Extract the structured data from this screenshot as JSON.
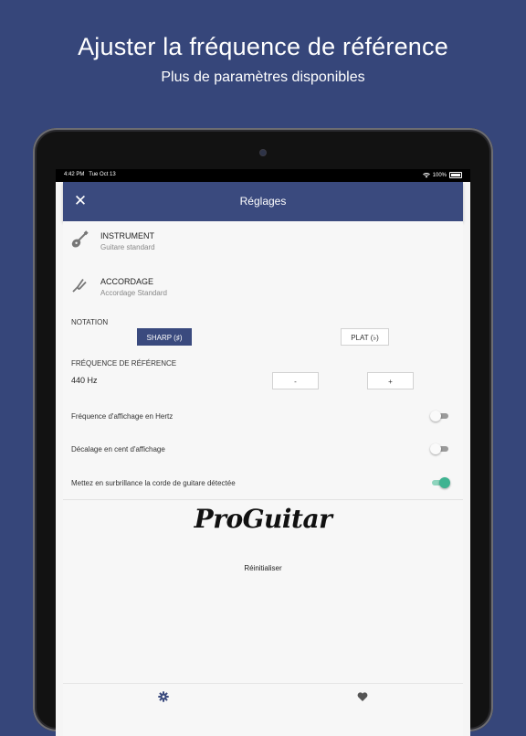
{
  "promo": {
    "title": "Ajuster la fréquence de référence",
    "subtitle": "Plus de paramètres disponibles"
  },
  "status_bar": {
    "time": "4:42 PM",
    "date": "Tue Oct 13",
    "battery": "100%"
  },
  "modal": {
    "title": "Réglages",
    "close_icon": "close-icon"
  },
  "settings": {
    "instrument": {
      "title": "INSTRUMENT",
      "value": "Guitare standard",
      "icon": "guitar-icon"
    },
    "tuning": {
      "title": "ACCORDAGE",
      "value": "Accordage Standard",
      "icon": "tuning-fork-icon"
    },
    "notation": {
      "label": "NOTATION",
      "options": [
        "SHARP (♯)",
        "PLAT (♭)"
      ],
      "selected": "SHARP (♯)"
    },
    "reference_frequency": {
      "label": "FRÉQUENCE DE RÉFÉRENCE",
      "value": "440 Hz",
      "decrement_label": "-",
      "increment_label": "+"
    },
    "toggles": [
      {
        "label": "Fréquence d'affichage en Hertz",
        "on": false
      },
      {
        "label": "Décalage en cent d'affichage",
        "on": false
      },
      {
        "label": "Mettez en surbrillance la corde de guitare détectée",
        "on": true
      }
    ]
  },
  "logo_text": "ProGuitar",
  "reset_label": "Réinitialiser",
  "tabbar": {
    "items": [
      {
        "icon": "gear-icon",
        "active": true
      },
      {
        "icon": "heart-icon",
        "active": false
      }
    ]
  },
  "colors": {
    "background": "#36467a",
    "header": "#3a4a7e",
    "toggle_on": "#3fb391"
  }
}
